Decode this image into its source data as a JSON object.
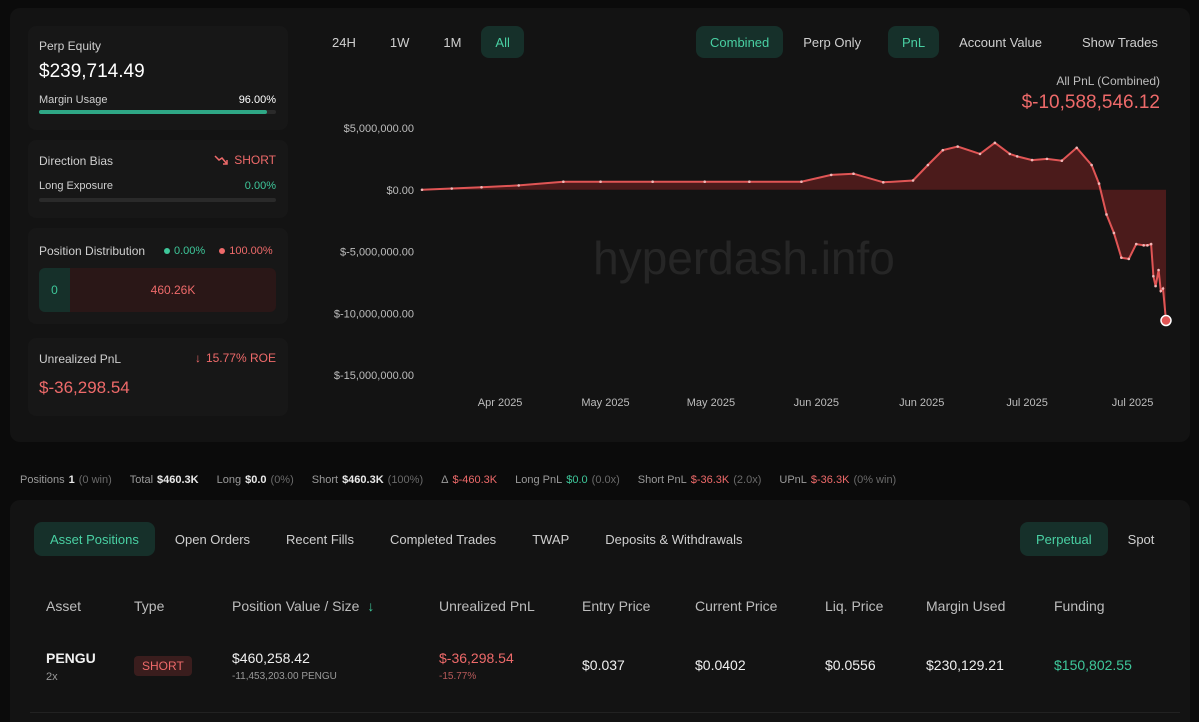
{
  "summary": {
    "perp_equity_label": "Perp Equity",
    "perp_equity_value": "$239,714.49",
    "margin_usage_label": "Margin Usage",
    "margin_usage_value": "96.00%",
    "margin_usage_fraction": 0.96,
    "direction_bias_label": "Direction Bias",
    "direction_bias_value": "SHORT",
    "long_exposure_label": "Long Exposure",
    "long_exposure_value": "0.00%",
    "position_distribution_label": "Position Distribution",
    "dist_long_pct": "0.00%",
    "dist_short_pct": "100.00%",
    "dist_long_value": "0",
    "dist_short_value": "460.26K",
    "unrealized_pnl_label": "Unrealized PnL",
    "roe": "15.77% ROE",
    "unrealized_pnl_value": "$-36,298.54"
  },
  "chart_controls": {
    "ranges": [
      "24H",
      "1W",
      "1M",
      "All"
    ],
    "active_range": "All",
    "modes": [
      "Combined",
      "Perp Only"
    ],
    "active_mode": "Combined",
    "metrics": [
      "PnL",
      "Account Value"
    ],
    "active_metric": "PnL",
    "show_trades": "Show Trades"
  },
  "chart_header": {
    "label": "All PnL (Combined)",
    "value": "$-10,588,546.12"
  },
  "watermark": "hyperdash.info",
  "chart_data": {
    "type": "area",
    "yticks": [
      "$5,000,000.00",
      "$0.00",
      "$-5,000,000.00",
      "$-10,000,000.00",
      "$-15,000,000.00"
    ],
    "ytick_values": [
      5000000,
      0,
      -5000000,
      -10000000,
      -15000000
    ],
    "xticks": [
      "Apr 2025",
      "May 2025",
      "May 2025",
      "Jun 2025",
      "Jun 2025",
      "Jul 2025",
      "Jul 2025"
    ],
    "ylim": [
      -15000000,
      5000000
    ],
    "x": [
      0,
      0.04,
      0.08,
      0.13,
      0.19,
      0.24,
      0.31,
      0.38,
      0.44,
      0.51,
      0.55,
      0.58,
      0.62,
      0.66,
      0.68,
      0.7,
      0.72,
      0.75,
      0.77,
      0.79,
      0.8,
      0.82,
      0.84,
      0.86,
      0.88,
      0.9,
      0.91,
      0.92,
      0.93,
      0.94,
      0.95,
      0.96,
      0.97,
      0.975,
      0.98,
      0.983,
      0.986,
      0.99,
      0.993,
      0.996,
      1.0
    ],
    "values": [
      0,
      100000,
      200000,
      350000,
      650000,
      650000,
      650000,
      650000,
      650000,
      650000,
      1200000,
      1300000,
      600000,
      750000,
      2000000,
      3200000,
      3500000,
      2900000,
      3800000,
      2900000,
      2700000,
      2400000,
      2500000,
      2350000,
      3400000,
      2000000,
      500000,
      -2000000,
      -3500000,
      -5500000,
      -5600000,
      -4400000,
      -4500000,
      -4500000,
      -4400000,
      -7000000,
      -7800000,
      -6500000,
      -8200000,
      -8000000,
      -10588546
    ],
    "series_color": "#e05555"
  },
  "stats_strip": {
    "positions_label": "Positions",
    "positions_value": "1",
    "positions_note": "(0 win)",
    "total_label": "Total",
    "total_value": "$460.3K",
    "long_label": "Long",
    "long_value": "$0.0",
    "long_note": "(0%)",
    "short_label": "Short",
    "short_value": "$460.3K",
    "short_note": "(100%)",
    "delta_label": "Δ",
    "delta_value": "$-460.3K",
    "long_pnl_label": "Long PnL",
    "long_pnl_value": "$0.0",
    "long_pnl_note": "(0.0x)",
    "short_pnl_label": "Short PnL",
    "short_pnl_value": "$-36.3K",
    "short_pnl_note": "(2.0x)",
    "upnl_label": "UPnL",
    "upnl_value": "$-36.3K",
    "upnl_note": "(0% win)"
  },
  "tabs": {
    "items": [
      "Asset Positions",
      "Open Orders",
      "Recent Fills",
      "Completed Trades",
      "TWAP",
      "Deposits & Withdrawals"
    ],
    "active": "Asset Positions",
    "right": [
      "Perpetual",
      "Spot"
    ],
    "right_active": "Perpetual"
  },
  "table": {
    "headers": [
      "Asset",
      "Type",
      "Position Value / Size",
      "Unrealized PnL",
      "Entry Price",
      "Current Price",
      "Liq. Price",
      "Margin Used",
      "Funding"
    ],
    "sort_icon": "arrow-down-icon",
    "row": {
      "asset": "PENGU",
      "leverage": "2x",
      "type": "SHORT",
      "position_value": "$460,258.42",
      "position_size": "-11,453,203.00 PENGU",
      "unrealized_pnl": "$-36,298.54",
      "unrealized_pct": "-15.77%",
      "entry_price": "$0.037",
      "current_price": "$0.0402",
      "liq_price": "$0.0556",
      "margin_used": "$230,129.21",
      "funding": "$150,802.55"
    }
  }
}
